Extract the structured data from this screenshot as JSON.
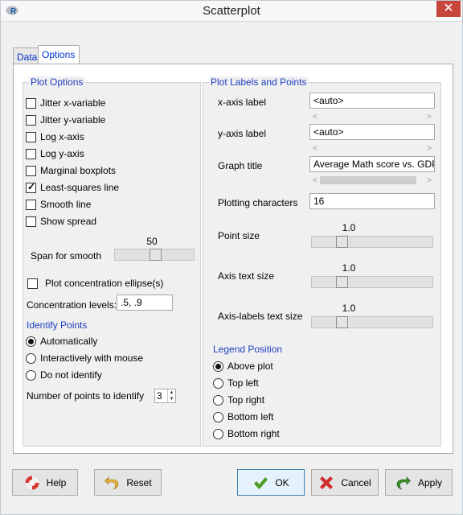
{
  "window": {
    "title": "Scatterplot"
  },
  "tabs": [
    {
      "label": "Data"
    },
    {
      "label": "Options"
    }
  ],
  "plot_options": {
    "title": "Plot Options",
    "checkboxes": [
      {
        "label": "Jitter x-variable",
        "checked": false
      },
      {
        "label": "Jitter y-variable",
        "checked": false
      },
      {
        "label": "Log x-axis",
        "checked": false
      },
      {
        "label": "Log y-axis",
        "checked": false
      },
      {
        "label": "Marginal boxplots",
        "checked": false
      },
      {
        "label": "Least-squares line",
        "checked": true
      },
      {
        "label": "Smooth line",
        "checked": false
      },
      {
        "label": "Show spread",
        "checked": false
      }
    ],
    "span_label": "Span for smooth",
    "span_value": "50",
    "span_fraction": 0.5,
    "ellipse_label": "Plot concentration ellipse(s)",
    "ellipse_checked": false,
    "conc_label": "Concentration levels:",
    "conc_value": ".5, .9"
  },
  "identify": {
    "title": "Identify Points",
    "options": [
      {
        "label": "Automatically",
        "selected": true
      },
      {
        "label": "Interactively with mouse",
        "selected": false
      },
      {
        "label": "Do not identify",
        "selected": false
      }
    ],
    "num_label": "Number of points to identify",
    "num_value": "3"
  },
  "labels": {
    "title": "Plot Labels and Points",
    "xlabel_label": "x-axis label",
    "xlabel_value": "<auto>",
    "ylabel_label": "y-axis label",
    "ylabel_value": "<auto>",
    "graph_title_label": "Graph title",
    "graph_title_value": "Average Math score vs. GDP",
    "plotting_chars_label": "Plotting characters",
    "plotting_chars_value": "16",
    "point_size_label": "Point size",
    "point_size_value": "1.0",
    "axis_text_label": "Axis text size",
    "axis_text_value": "1.0",
    "axis_labels_label": "Axis-labels text size",
    "axis_labels_value": "1.0"
  },
  "legend": {
    "title": "Legend Position",
    "options": [
      {
        "label": "Above plot",
        "selected": true
      },
      {
        "label": "Top left",
        "selected": false
      },
      {
        "label": "Top right",
        "selected": false
      },
      {
        "label": "Bottom left",
        "selected": false
      },
      {
        "label": "Bottom right",
        "selected": false
      }
    ]
  },
  "buttons": {
    "help": "Help",
    "reset": "Reset",
    "ok": "OK",
    "cancel": "Cancel",
    "apply": "Apply"
  },
  "icons": {
    "help": "lifebuoy-icon",
    "reset": "undo-arrow-icon",
    "ok": "checkmark-icon",
    "cancel": "red-x-icon",
    "apply": "redo-arrow-icon"
  },
  "colors": {
    "section_title": "#1f3fbf",
    "ok_check": "#4a9e1d",
    "cancel_x": "#d0302d",
    "apply_arrow": "#3d8d2b"
  }
}
